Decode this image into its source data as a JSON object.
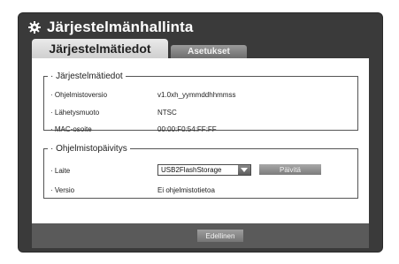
{
  "window": {
    "title": "Järjestelmänhallinta"
  },
  "tabs": [
    {
      "label": "Järjestelmätiedot",
      "active": true
    },
    {
      "label": "Asetukset",
      "active": false
    }
  ],
  "system_info": {
    "legend": "· Järjestelmätiedot",
    "rows": [
      {
        "label": "· Ohjelmistoversio",
        "value": "v1.0xh_yymmddhhmmss"
      },
      {
        "label": "· Lähetysmuoto",
        "value": "NTSC"
      },
      {
        "label": "· MAC-osoite",
        "value": "00:00:F0:54:FF:FF"
      }
    ]
  },
  "software_update": {
    "legend": "· Ohjelmistopäivitys",
    "device_label": "· Laite",
    "device_selected": "USB2FlashStorage",
    "update_button": "Päivitä",
    "version_label": "· Versio",
    "version_value": "Ei ohjelmistotietoa"
  },
  "footer": {
    "back_button": "Edellinen"
  },
  "colors": {
    "window_bg": "#3a3a3a",
    "panel_bg": "#ffffff",
    "footer_bg": "#5a5a5a",
    "active_tab": "#dcdcdc",
    "inactive_tab": "#808080"
  },
  "icons": {
    "title_icon": "gear-icon",
    "dropdown_icon": "chevron-down-icon"
  }
}
